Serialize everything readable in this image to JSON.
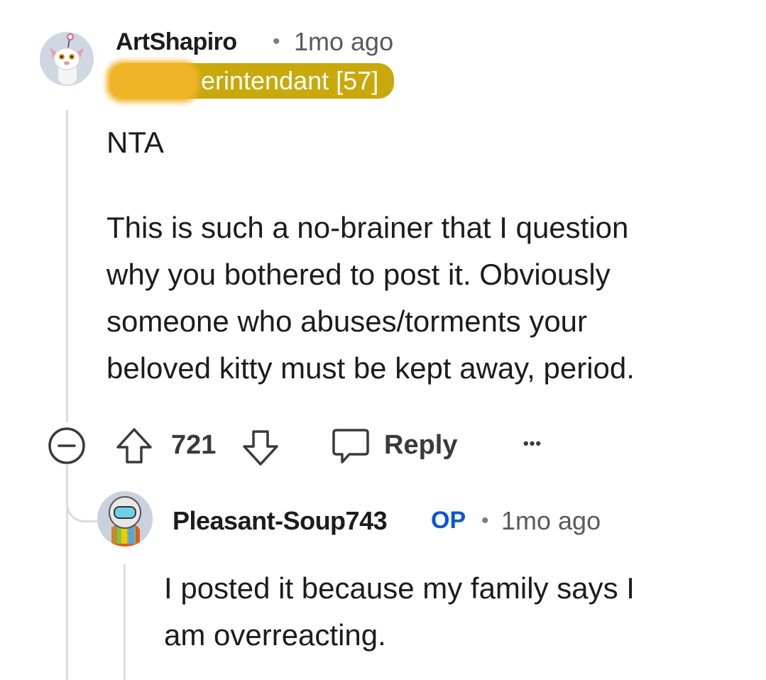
{
  "comment": {
    "author": "ArtShapiro",
    "separator": "•",
    "time": "1mo ago",
    "flair": "erintendant [57]",
    "body_line1": "NTA",
    "body_lines": [
      "This is such a no-brainer that I question",
      "why you bothered to post it. Obviously",
      "someone who abuses/torments your",
      "beloved kitty must be kept away, period."
    ],
    "score": "721",
    "reply_label": "Reply",
    "more_label": "•••"
  },
  "reply": {
    "author": "Pleasant-Soup743",
    "op_badge": "OP",
    "separator": "•",
    "time": "1mo ago",
    "body_lines": [
      "I posted it because my family says I",
      "am overreacting."
    ]
  },
  "icons": {
    "collapse": "minus-circle-icon",
    "upvote": "arrow-up-icon",
    "downvote": "arrow-down-icon",
    "reply": "speech-bubble-icon",
    "more": "ellipsis-icon"
  },
  "colors": {
    "flair_bg": "#c9a80a",
    "op_blue": "#0a57d0",
    "thread_line": "#dcdcdc"
  }
}
